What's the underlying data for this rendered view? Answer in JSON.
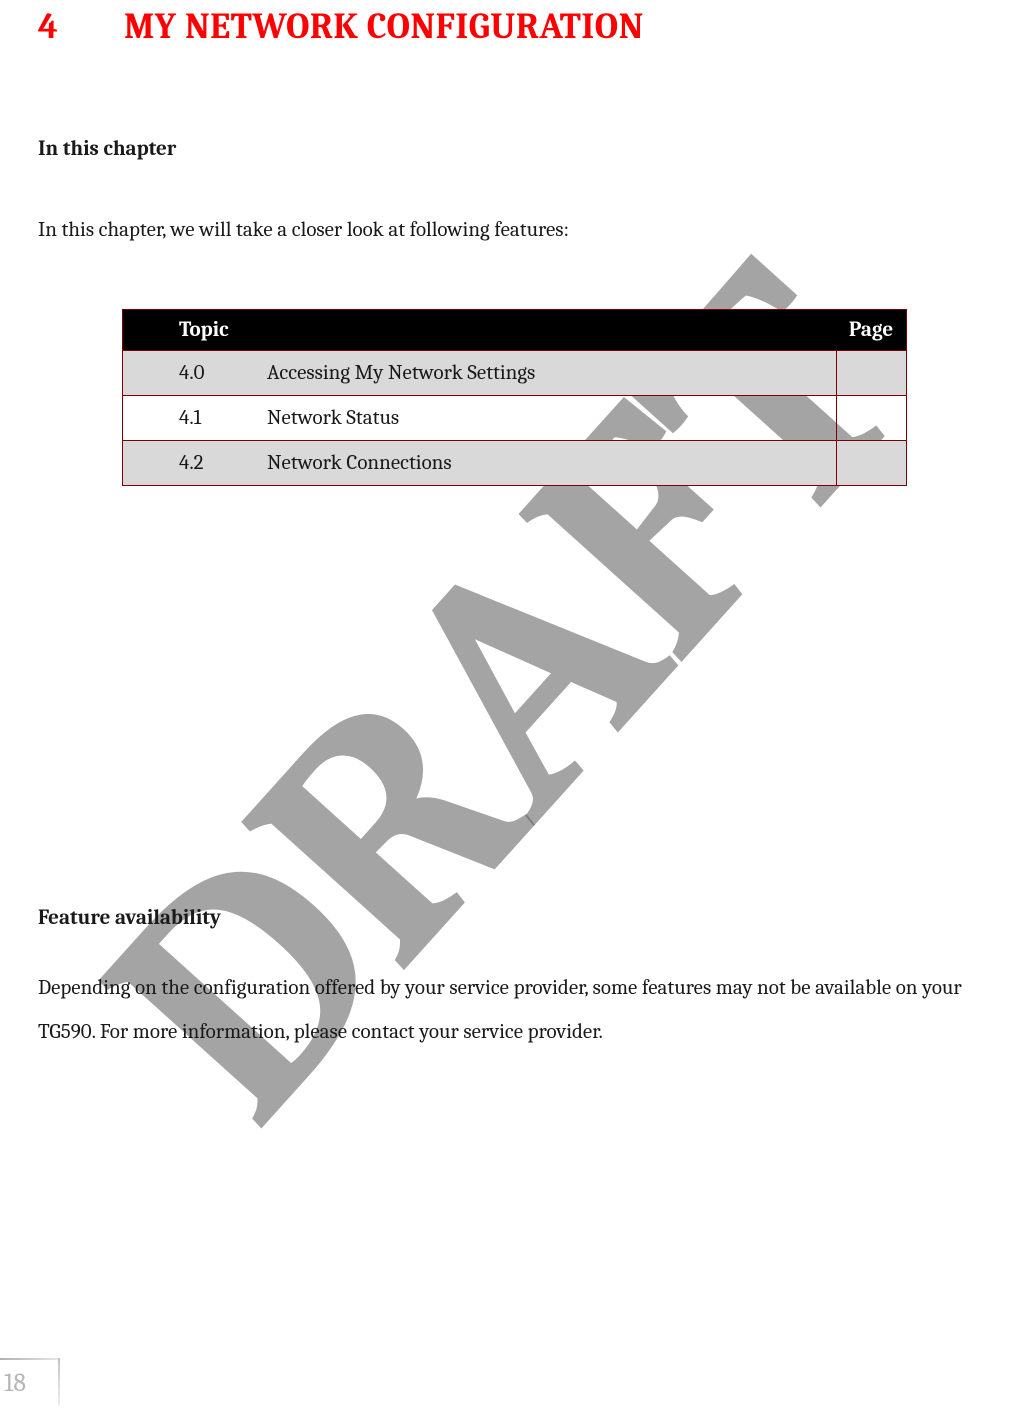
{
  "watermark": "DRAFT",
  "chapter": {
    "number": "4",
    "title": "MY NETWORK CONFIGURATION"
  },
  "section1": {
    "label": "In this chapter",
    "intro": "In this chapter, we will take a closer look at following features:"
  },
  "toc_table": {
    "headers": {
      "topic": "Topic",
      "page": "Page"
    },
    "rows": [
      {
        "num": "4.0",
        "title": "Accessing My Network Settings",
        "page": ""
      },
      {
        "num": "4.1",
        "title": "Network Status",
        "page": ""
      },
      {
        "num": "4.2",
        "title": "Network Connections",
        "page": ""
      }
    ]
  },
  "section2": {
    "label": "Feature availability",
    "body": "Depending on the configuration offered by your service provider, some features may not be available on your TG590. For more information, please contact your service provider."
  },
  "page_number": "18"
}
